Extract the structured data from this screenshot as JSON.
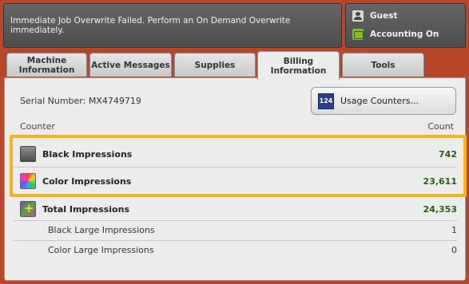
{
  "header": {
    "message": "Immediate Job Overwrite Failed.  Perform an On Demand Overwrite immediately.",
    "user": "Guest",
    "accounting": "Accounting On"
  },
  "tabs": [
    {
      "label": "Machine Information"
    },
    {
      "label": "Active Messages"
    },
    {
      "label": "Supplies"
    },
    {
      "label": "Billing Information"
    },
    {
      "label": "Tools"
    }
  ],
  "billing": {
    "serial_label": "Serial Number: MX4749719",
    "usage_button": "Usage Counters...",
    "usage_icon_text": "124",
    "col_counter": "Counter",
    "col_count": "Count",
    "rows": [
      {
        "label": "Black Impressions",
        "value": "742"
      },
      {
        "label": "Color Impressions",
        "value": "23,611"
      },
      {
        "label": "Total Impressions",
        "value": "24,353"
      },
      {
        "label": "Black Large Impressions",
        "value": "1"
      },
      {
        "label": "Color Large Impressions",
        "value": "0"
      }
    ]
  },
  "colors": {
    "background": "#b7462a",
    "highlight": "#f0b522",
    "count_green": "#2e5a1a"
  }
}
